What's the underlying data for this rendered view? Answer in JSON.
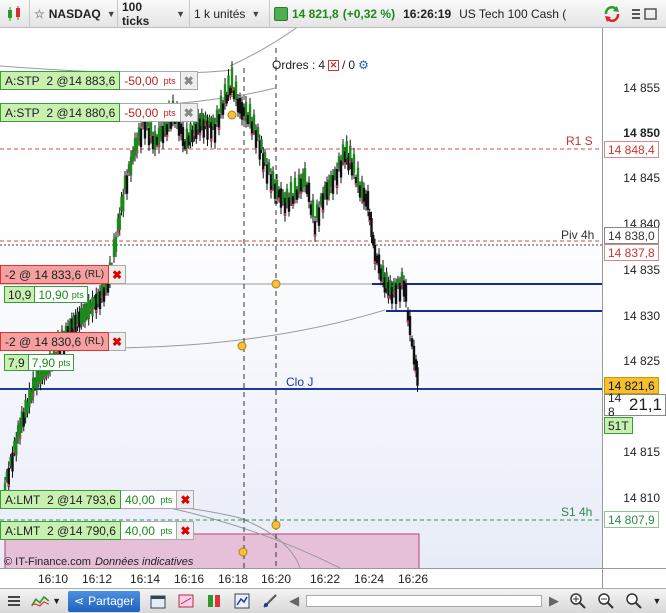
{
  "toolbar": {
    "symbol": "NASDAQ",
    "interval": "100 ticks",
    "units": "1 k unités",
    "last": "14 821,8",
    "change": "(+0,32 %)",
    "time": "16:26:19",
    "instrument": "US Tech 100 Cash ("
  },
  "orders_header": {
    "label": "Ordres :",
    "count_a": "4",
    "count_b": "0"
  },
  "orders": [
    {
      "type": "A:STP",
      "qty": "2",
      "price": "@14 883,6",
      "pts": "-50,00",
      "unit": "pts"
    },
    {
      "type": "A:STP",
      "qty": "2",
      "price": "@14 880,6",
      "pts": "-50,00",
      "unit": "pts"
    },
    {
      "type": "A:LMT",
      "qty": "2",
      "price": "@14 793,6",
      "pts": "40,00",
      "unit": "pts"
    },
    {
      "type": "A:LMT",
      "qty": "2",
      "price": "@14 790,6",
      "pts": "40,00",
      "unit": "pts"
    }
  ],
  "positions": [
    {
      "label": "-2 @ 14 833,6",
      "tag": "(RL)",
      "pnl_a": "10,9",
      "pnl_b": "10,90",
      "unit": "pts"
    },
    {
      "label": "-2 @ 14 830,6",
      "tag": "(RL)",
      "pnl_a": "7,9",
      "pnl_b": "7,90",
      "unit": "pts"
    }
  ],
  "levels": {
    "r1": "R1 S",
    "r1_price": "14 848,4",
    "piv": "Piv 4h",
    "piv_price_a": "14 838,0",
    "piv_price_b": "14 837,8",
    "clo": "Clo J",
    "clo_price": "14 821,6",
    "s1": "S1 4h",
    "s1_price": "14 807,9"
  },
  "yaxis": {
    "ticks": [
      "14 855",
      "14 850",
      "14 845",
      "14 840",
      "14 835",
      "14 830",
      "14 825",
      "14 815",
      "14 810"
    ],
    "current_prefix": "14 8",
    "current_big": "21,1",
    "ticks_left": "51T"
  },
  "xaxis": {
    "ticks": [
      "16:10",
      "16:12",
      "16:14",
      "16:16",
      "16:18",
      "16:20",
      "16:22",
      "16:24",
      "16:26"
    ]
  },
  "footer": {
    "source": "© IT-Finance.com",
    "note": "Données indicatives"
  },
  "bottombar": {
    "share": "Partager"
  },
  "colors": {
    "up": "#1a8a1a",
    "down": "#111",
    "level_red": "#d44",
    "level_blue": "#1a3aa0"
  }
}
